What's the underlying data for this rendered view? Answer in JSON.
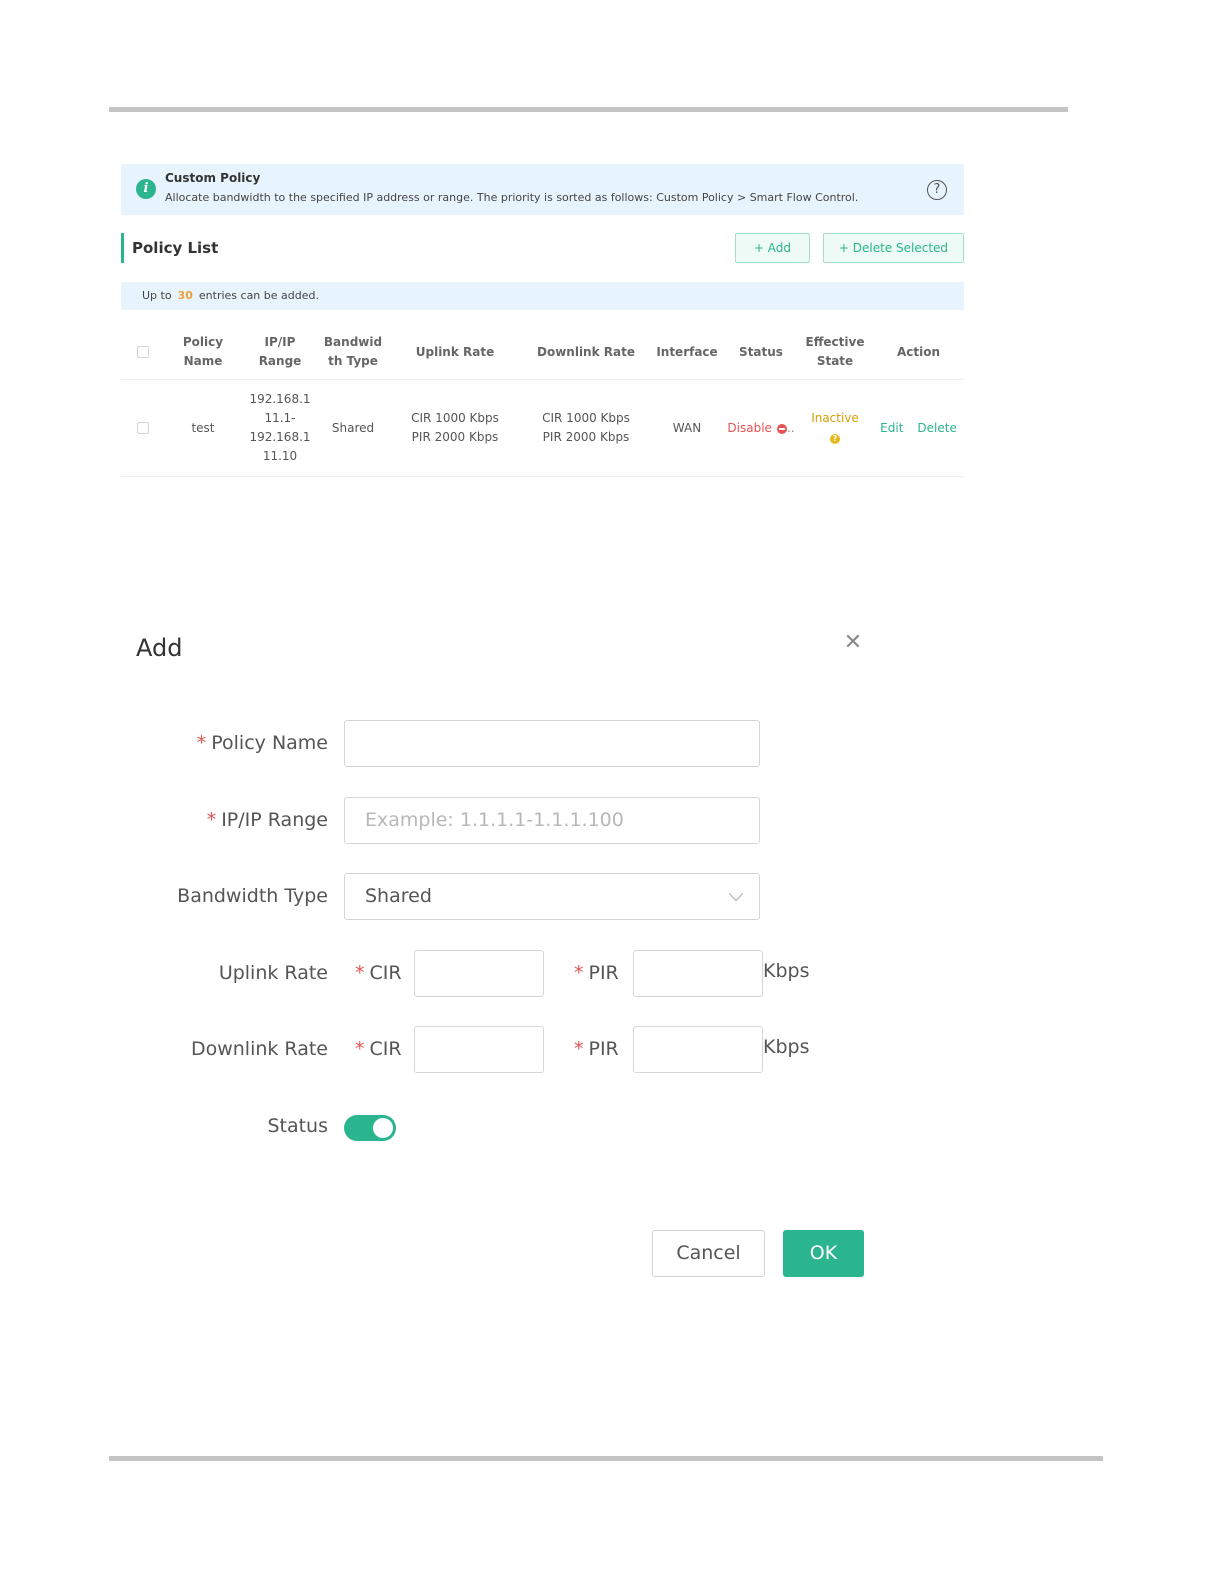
{
  "banner": {
    "title": "Custom Policy",
    "description": "Allocate bandwidth to the specified IP address or range. The priority is sorted as follows: Custom Policy > Smart Flow Control.",
    "help_icon": "question-circle-icon",
    "info_icon": "info-icon"
  },
  "policy_list": {
    "title": "Policy List",
    "add_label": "+ Add",
    "delete_selected_label": "+ Delete Selected",
    "limit_prefix": "Up to",
    "limit_count": "30",
    "limit_suffix": "entries can be added."
  },
  "table": {
    "headers": {
      "name": [
        "Policy",
        "Name"
      ],
      "ip": [
        "IP/IP",
        "Range"
      ],
      "bw": [
        "Bandwid",
        "th Type"
      ],
      "uplink": "Uplink Rate",
      "downlink": "Downlink Rate",
      "interface": "Interface",
      "status": "Status",
      "effective": [
        "Effective",
        "State"
      ],
      "action": "Action"
    },
    "rows": [
      {
        "name": "test",
        "ip": [
          "192.168.1",
          "11.1-",
          "192.168.1",
          "11.10"
        ],
        "bw": "Shared",
        "uplink": [
          "CIR 1000 Kbps",
          "PIR 2000 Kbps"
        ],
        "downlink": [
          "CIR 1000 Kbps",
          "PIR 2000 Kbps"
        ],
        "interface": "WAN",
        "status": "Disable",
        "status_ellipsis": "..",
        "effective": "Inactive",
        "edit": "Edit",
        "delete": "Delete"
      }
    ]
  },
  "dialog": {
    "title": "Add",
    "close_icon": "close-icon",
    "required_mark": "*",
    "policy_name_label": "Policy Name",
    "policy_name_value": "",
    "ip_range_label": "IP/IP Range",
    "ip_range_placeholder": "Example: 1.1.1.1-1.1.1.100",
    "bandwidth_type_label": "Bandwidth Type",
    "bandwidth_type_value": "Shared",
    "uplink_label": "Uplink Rate",
    "downlink_label": "Downlink Rate",
    "cir_label": "CIR",
    "pir_label": "PIR",
    "unit": "Kbps",
    "status_label": "Status",
    "status_on": true,
    "cancel_label": "Cancel",
    "ok_label": "OK"
  },
  "colors": {
    "accent": "#2bb58e",
    "danger": "#e55353",
    "warning": "#d4a10b",
    "banner_bg": "#e8f4fd"
  }
}
